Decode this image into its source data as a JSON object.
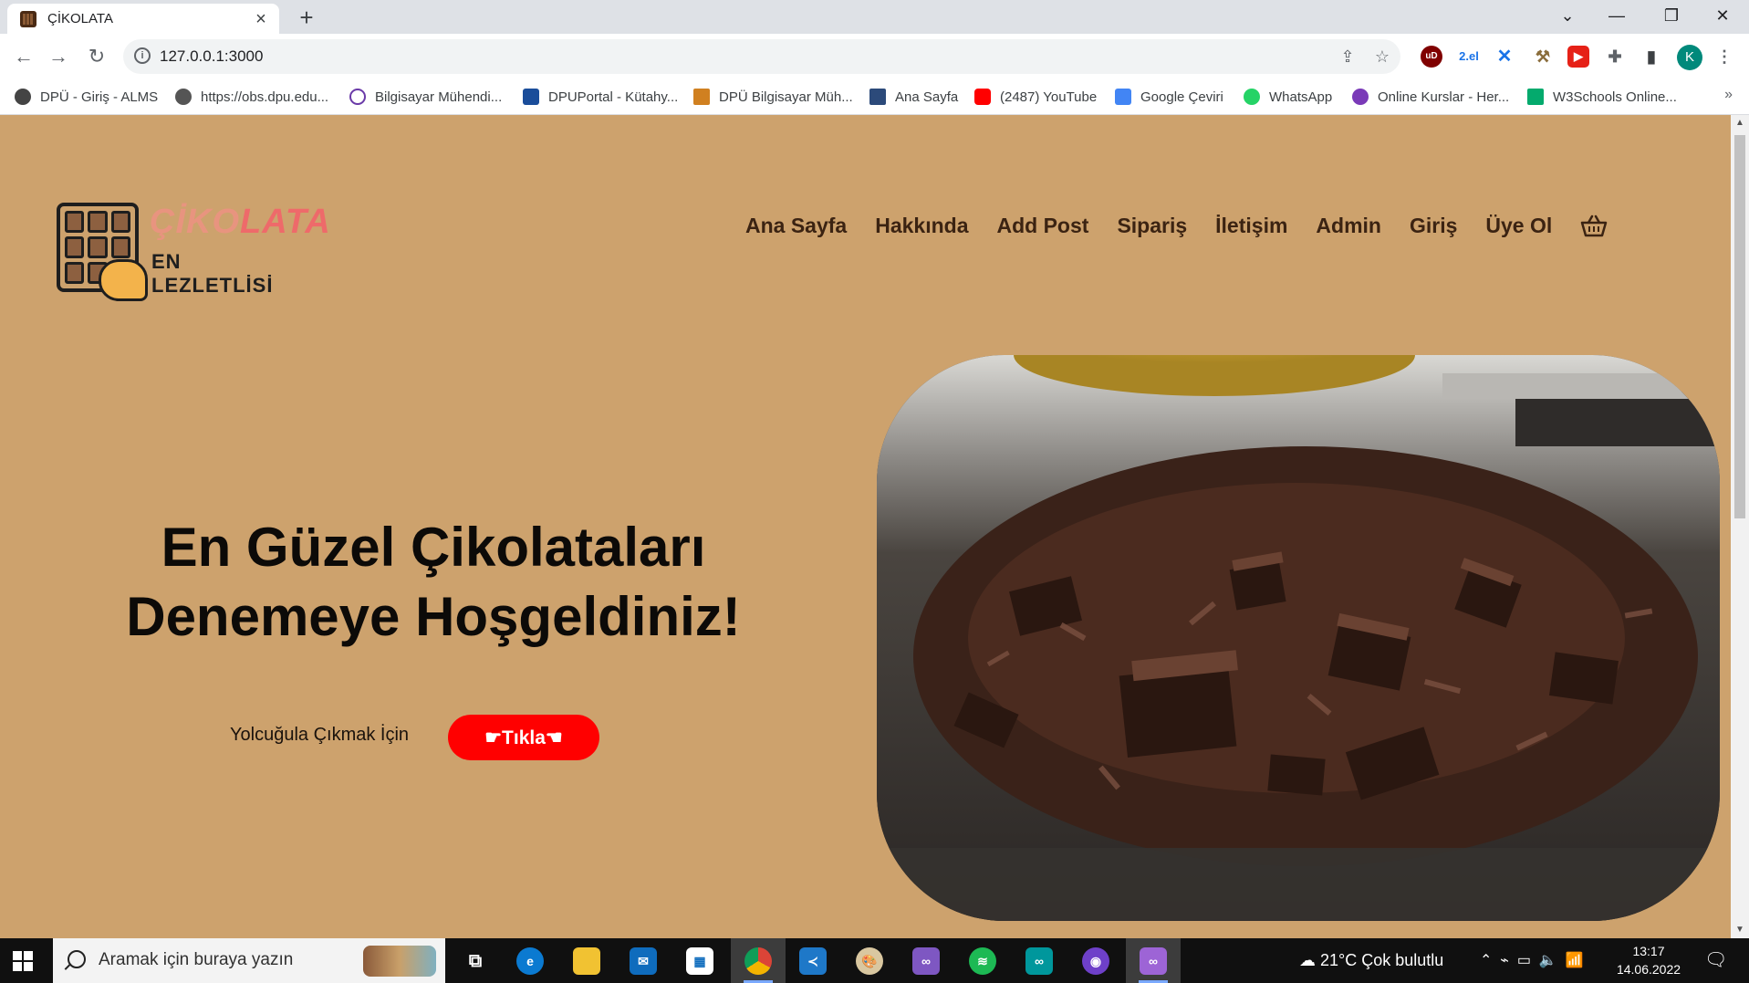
{
  "browser": {
    "tab_title": "ÇİKOLATA",
    "url": "127.0.0.1:3000",
    "ext_2el_label": "2.el",
    "ext_ud_label": "uD",
    "avatar_letter": "K",
    "bookmarks": [
      {
        "label": "DPÜ - Giriş - ALMS",
        "color": "#444"
      },
      {
        "label": "https://obs.dpu.edu...",
        "color": "#555"
      },
      {
        "label": "Bilgisayar Mühendi...",
        "color": "#6a3aa8"
      },
      {
        "label": "DPUPortal - Kütahy...",
        "color": "#1a4d9a"
      },
      {
        "label": "DPÜ Bilgisayar Müh...",
        "color": "#d08020"
      },
      {
        "label": "Ana Sayfa",
        "color": "#2c4a7a"
      },
      {
        "label": "(2487) YouTube",
        "color": "#ff0000"
      },
      {
        "label": "Google Çeviri",
        "color": "#4285f4"
      },
      {
        "label": "WhatsApp",
        "color": "#25d366"
      },
      {
        "label": "Online Kurslar - Her...",
        "color": "#7a3ab8"
      },
      {
        "label": "W3Schools Online...",
        "color": "#04aa6d"
      }
    ],
    "bookmarks_more": "»"
  },
  "site": {
    "logo_title_a": "ÇİKO",
    "logo_title_b": "LATA",
    "logo_subtitle": "EN LEZLETLİSİ",
    "nav": [
      "Ana Sayfa",
      "Hakkında",
      "Add Post",
      "Sipariş",
      "İletişim",
      "Admin",
      "Giriş",
      "Üye Ol"
    ],
    "hero_title_line1": "En Güzel Çikolataları",
    "hero_title_line2": "Denemeye Hoşgeldiniz!",
    "hero_lead": "Yolcuğula Çıkmak İçin",
    "hero_button": "☛Tıkla☚"
  },
  "taskbar": {
    "search_placeholder": "Aramak için buraya yazın",
    "weather": "21°C  Çok bulutlu",
    "time": "13:17",
    "date": "14.06.2022"
  },
  "colors": {
    "page_bg": "#cda26d",
    "cta": "#ff0000",
    "logo_accent": "#ee6a6a"
  }
}
